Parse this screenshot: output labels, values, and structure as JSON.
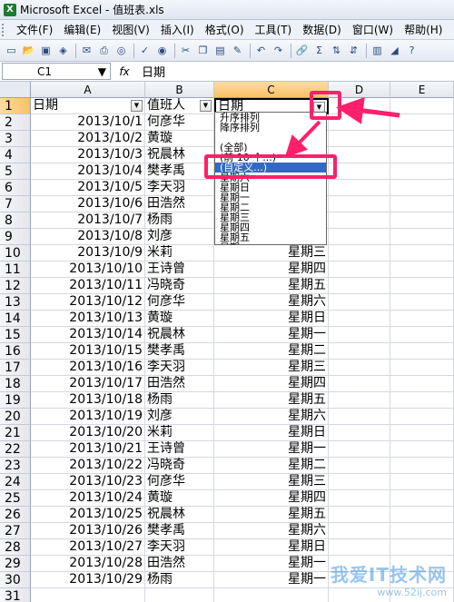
{
  "window": {
    "app_icon": "X",
    "title": "Microsoft Excel - 值班表.xls"
  },
  "menu": [
    "文件(F)",
    "编辑(E)",
    "视图(V)",
    "插入(I)",
    "格式(O)",
    "工具(T)",
    "数据(D)",
    "窗口(W)",
    "帮助(H)"
  ],
  "toolbar": {
    "zoom_symbol": "Σ",
    "help_symbol": "?"
  },
  "formula_bar": {
    "name_box": "C1",
    "fx": "fx",
    "formula": "日期"
  },
  "columns": [
    "A",
    "B",
    "C",
    "D",
    "E"
  ],
  "header_row": [
    "日期",
    "值班人",
    "日期"
  ],
  "rows": [
    [
      "2013/10/1",
      "何彦华",
      ""
    ],
    [
      "2013/10/2",
      "黄璇",
      ""
    ],
    [
      "2013/10/3",
      "祝晨林",
      ""
    ],
    [
      "2013/10/4",
      "樊孝禹",
      ""
    ],
    [
      "2013/10/5",
      "李天羽",
      ""
    ],
    [
      "2013/10/6",
      "田浩然",
      ""
    ],
    [
      "2013/10/7",
      "杨雨",
      ""
    ],
    [
      "2013/10/8",
      "刘彦",
      ""
    ],
    [
      "2013/10/9",
      "米莉",
      "星期三"
    ],
    [
      "2013/10/10",
      "王诗曾",
      "星期四"
    ],
    [
      "2013/10/11",
      "冯晓奇",
      "星期五"
    ],
    [
      "2013/10/12",
      "何彦华",
      "星期六"
    ],
    [
      "2013/10/13",
      "黄璇",
      "星期日"
    ],
    [
      "2013/10/14",
      "祝晨林",
      "星期一"
    ],
    [
      "2013/10/15",
      "樊孝禹",
      "星期二"
    ],
    [
      "2013/10/16",
      "李天羽",
      "星期三"
    ],
    [
      "2013/10/17",
      "田浩然",
      "星期四"
    ],
    [
      "2013/10/18",
      "杨雨",
      "星期五"
    ],
    [
      "2013/10/19",
      "刘彦",
      "星期六"
    ],
    [
      "2013/10/20",
      "米莉",
      "星期日"
    ],
    [
      "2013/10/21",
      "王诗曾",
      "星期一"
    ],
    [
      "2013/10/22",
      "冯晓奇",
      "星期二"
    ],
    [
      "2013/10/23",
      "何彦华",
      "星期三"
    ],
    [
      "2013/10/24",
      "黄璇",
      "星期四"
    ],
    [
      "2013/10/25",
      "祝晨林",
      "星期五"
    ],
    [
      "2013/10/26",
      "樊孝禹",
      "星期六"
    ],
    [
      "2013/10/27",
      "李天羽",
      "星期日"
    ],
    [
      "2013/10/28",
      "田浩然",
      "星期一"
    ],
    [
      "2013/10/29",
      "杨雨",
      "星期一"
    ],
    [
      "",
      "",
      ""
    ]
  ],
  "filter_dropdown": {
    "items": [
      "升序排列",
      "降序排列",
      "",
      "(全部)",
      "(前 10 个...)",
      "(自定义...)",
      "星期六",
      "星期日",
      "星期一",
      "星期二",
      "星期三",
      "星期四",
      "星期五",
      "星期一"
    ],
    "highlighted_index": 5
  },
  "watermark": {
    "main": "我爱IT技术网",
    "url": "www.52ij.com"
  },
  "colors": {
    "highlight": "#ff1f6b",
    "selection": "#316ac5"
  }
}
